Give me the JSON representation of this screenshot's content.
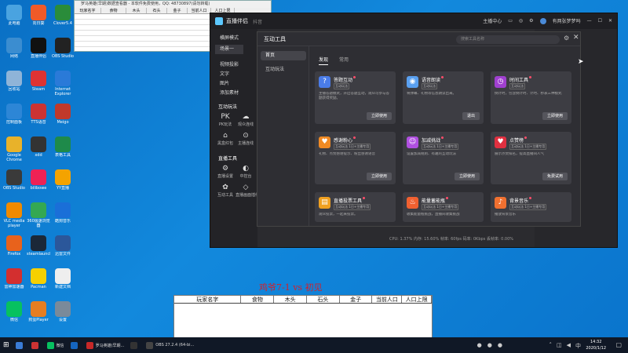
{
  "desktop_icons": [
    {
      "label": "此电脑",
      "color": "#4aa3e0"
    },
    {
      "label": "向日葵",
      "color": "#f05a28"
    },
    {
      "label": "Clover5.4",
      "color": "#2a8c3a"
    },
    {
      "label": "网络",
      "color": "#3b8dd0"
    },
    {
      "label": "直播伴侣",
      "color": "#111111"
    },
    {
      "label": "OBS Studio",
      "color": "#222222"
    },
    {
      "label": "回收站",
      "color": "#8fb4d8"
    },
    {
      "label": "Steam",
      "color": "#d33"
    },
    {
      "label": "Internet Explorer",
      "color": "#2a7ad8"
    },
    {
      "label": "控制面板",
      "color": "#2d86d6"
    },
    {
      "label": "TTS语音",
      "color": "#cc3333"
    },
    {
      "label": "Meigo",
      "color": "#c0392b"
    },
    {
      "label": "Google Chrome",
      "color": "#e8b22a"
    },
    {
      "label": "xdd",
      "color": "#333"
    },
    {
      "label": "表格工具",
      "color": "#1e8a4a"
    },
    {
      "label": "OBS Studio",
      "color": "#3a3a3a"
    },
    {
      "label": "bilibowe",
      "color": "#e25"
    },
    {
      "label": "YY直播",
      "color": "#f4a300"
    },
    {
      "label": "VLC media player",
      "color": "#f08a00"
    },
    {
      "label": "360极速浏览器",
      "color": "#34a853"
    },
    {
      "label": "酷狗音乐",
      "color": "#1a6fd8"
    },
    {
      "label": "Firefox",
      "color": "#e8621c"
    },
    {
      "label": "steamlauncher",
      "color": "#1b2838"
    },
    {
      "label": "迅雷文件",
      "color": "#2b579a"
    },
    {
      "label": "雷神加速器",
      "color": "#d32f2f"
    },
    {
      "label": "Pacman",
      "color": "#f6d000"
    },
    {
      "label": "新建文档",
      "color": "#eeeeee"
    },
    {
      "label": "微信",
      "color": "#07c160"
    },
    {
      "label": "狗蛋Player",
      "color": "#e67e22"
    },
    {
      "label": "设置",
      "color": "#7a8a9a"
    }
  ],
  "game_window": {
    "title": "罗马英雄(早期)数据查看器 - 本软件免费使用，QQ: 48730897(请勿转载)",
    "columns": [
      "玩家名字",
      "食物",
      "木头",
      "石头",
      "金子",
      "当前人口",
      "人口上限"
    ]
  },
  "bottom_table": {
    "title": "鸡爷7-1  vs  初见",
    "columns": [
      "玩家名字",
      "食物",
      "木头",
      "石头",
      "金子",
      "当前人口",
      "人口上限"
    ]
  },
  "app": {
    "name": "直播伴侣",
    "beta": "抖音",
    "top_right": [
      "主播中心",
      "",
      "",
      "",
      "",
      "有两张梦梦吗"
    ],
    "side": {
      "mode": "横屏模式",
      "scene": "场景一",
      "items": [
        "视频投影",
        "文字",
        "图片",
        "添加素材"
      ],
      "section1": "互动玩法",
      "tools1": [
        {
          "g": "PK",
          "l": "PK玩法"
        },
        {
          "g": "☁",
          "l": "观众连线"
        },
        {
          "g": "⌂",
          "l": "黑盒红包"
        },
        {
          "g": "⊙",
          "l": "主播连线"
        }
      ],
      "section2": "直播工具",
      "tools2": [
        {
          "g": "⚙",
          "l": "直播设置"
        },
        {
          "g": "◐",
          "l": "中控台"
        },
        {
          "g": "✿",
          "l": "互动工具"
        },
        {
          "g": "◇",
          "l": "直播画面插件"
        }
      ],
      "extra": [
        "直播管理",
        "更多功能"
      ]
    },
    "status": "CPU: 1.37%   内存: 15.60%   帧率: 60fps   码率: 0Kbps   丢帧率: 0.00%"
  },
  "dialog": {
    "title": "互动工具",
    "search_placeholder": "搜索工具名称",
    "left_nav": [
      "首页",
      "互动玩法"
    ],
    "tabs": [
      "发现",
      "常用"
    ],
    "cards": [
      {
        "name": "答题互动",
        "tag": "互动玩法",
        "desc": "主播答题模式，开启答题互动，观众可参与答题获得奖励。",
        "button": "立即使用",
        "color": "#4a7ce8",
        "icon": "?"
      },
      {
        "name": "语音朗读",
        "tag": "互动玩法",
        "desc": "将弹幕、礼物等信息朗读出来。",
        "button": "退出",
        "color": "#5aa0f0",
        "icon": "◉"
      },
      {
        "name": "时间工具",
        "tag": "互动玩法",
        "desc": "倒计时，包含倒计时、计时、秒表三种模式",
        "button": "立即使用",
        "color": "#a040d0",
        "icon": "◷"
      },
      {
        "name": "感谢粉心",
        "tag": "互动玩法   1日+主播专用",
        "desc": "礼物、点赞感谢提示、粉丝感谢语音",
        "button": "立即使用",
        "color": "#f08a24",
        "icon": "♥"
      },
      {
        "name": "加减挑战",
        "tag": "互动玩法   1日+主播专用",
        "desc": "设置加减规则、有趣的互动玩法",
        "button": "立即使用",
        "color": "#b050e0",
        "icon": "☺"
      },
      {
        "name": "点赞榜",
        "tag": "互动玩法   1日+主播专用",
        "desc": "展示点赞排名，提高直播间人气",
        "button": "免费试用",
        "color": "#e03040",
        "icon": "♥"
      },
      {
        "name": "直播投票工具",
        "tag": "互动玩法   1日+主播专用",
        "desc": "观众投票，一起来投票。",
        "button": "",
        "color": "#f0a020",
        "icon": "▤"
      },
      {
        "name": "能量蓄能瓶",
        "tag": "互动玩法   1日+主播专用",
        "desc": "收集能量瓶挑战，直播间收集挑战",
        "button": "",
        "color": "#f06030",
        "icon": "♨"
      },
      {
        "name": "背景音乐",
        "tag": "互动玩法   1日+主播专用",
        "desc": "播放背景音乐",
        "button": "",
        "color": "#f07030",
        "icon": "♪"
      }
    ]
  },
  "taskbar": {
    "items": [
      {
        "label": "",
        "color": "#3a7bd5"
      },
      {
        "label": "",
        "color": "#cc3333"
      },
      {
        "label": "微信",
        "color": "#07c160"
      },
      {
        "label": "",
        "color": "#1565c0"
      },
      {
        "label": "罗马英雄(早期...",
        "color": "#c62828"
      },
      {
        "label": "",
        "color": "#333333"
      },
      {
        "label": "OBS 27.2.4 (64-bi...",
        "color": "#444444"
      }
    ],
    "time": "14:32",
    "date": "2020/1/12"
  }
}
